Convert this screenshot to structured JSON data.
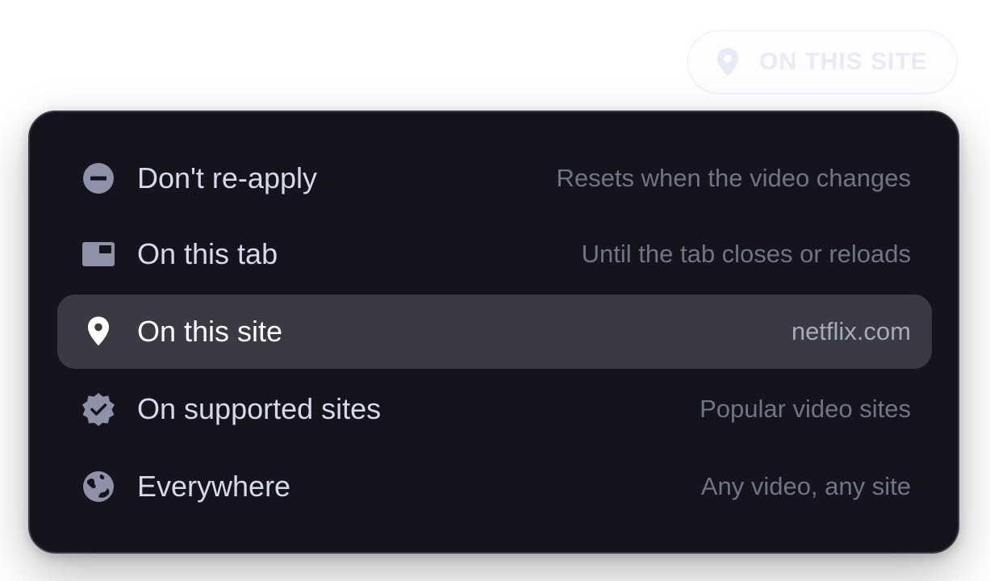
{
  "scope_button": {
    "label": "ON THIS SITE",
    "icon": "location-pin-icon",
    "color": "#e8eaf8"
  },
  "menu": {
    "background": "#15141c",
    "selected_background": "#393a44",
    "items": [
      {
        "label": "Don't re-apply",
        "description": "Resets when the video changes",
        "icon": "minus-circle-icon",
        "selected": false
      },
      {
        "label": "On this tab",
        "description": "Until the tab closes or reloads",
        "icon": "tab-icon",
        "selected": false
      },
      {
        "label": "On this site",
        "description": "netflix.com",
        "icon": "location-pin-icon",
        "selected": true
      },
      {
        "label": "On supported sites",
        "description": "Popular video sites",
        "icon": "verified-badge-icon",
        "selected": false
      },
      {
        "label": "Everywhere",
        "description": "Any video, any site",
        "icon": "globe-icon",
        "selected": false
      }
    ]
  }
}
